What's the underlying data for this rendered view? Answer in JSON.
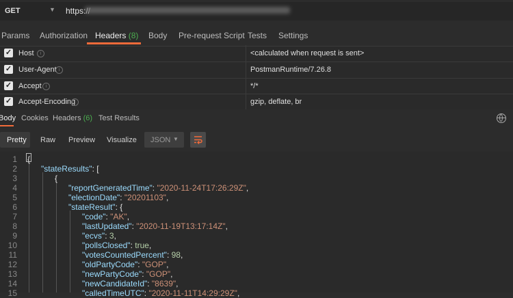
{
  "request": {
    "method": "GET",
    "url_prefix": "https://"
  },
  "request_tabs": {
    "params": "Params",
    "authorization": "Authorization",
    "headers": "Headers",
    "headers_count": "(8)",
    "body": "Body",
    "prerequest": "Pre-request Script",
    "tests": "Tests",
    "settings": "Settings"
  },
  "headers": [
    {
      "key": "Host",
      "value": "<calculated when request is sent>"
    },
    {
      "key": "User-Agent",
      "value": "PostmanRuntime/7.26.8"
    },
    {
      "key": "Accept",
      "value": "*/*"
    },
    {
      "key": "Accept-Encoding",
      "value": "gzip, deflate, br"
    }
  ],
  "response_tabs": {
    "body": "Body",
    "cookies": "Cookies",
    "headers": "Headers",
    "headers_count": "(6)",
    "tests": "Test Results"
  },
  "view_modes": {
    "pretty": "Pretty",
    "raw": "Raw",
    "preview": "Preview",
    "visualize": "Visualize",
    "format": "JSON"
  },
  "code": {
    "line_numbers": [
      "1",
      "2",
      "3",
      "4",
      "5",
      "6",
      "7",
      "8",
      "9",
      "10",
      "11",
      "12",
      "13",
      "14",
      "15"
    ],
    "l1": "{",
    "l2k": "\"stateResults\"",
    "l2r": ": [",
    "l3": "{",
    "l4k": "\"reportGeneratedTime\"",
    "l4v": "\"2020-11-24T17:26:29Z\"",
    "l5k": "\"electionDate\"",
    "l5v": "\"20201103\"",
    "l6k": "\"stateResult\"",
    "l6r": ": {",
    "l7k": "\"code\"",
    "l7v": "\"AK\"",
    "l8k": "\"lastUpdated\"",
    "l8v": "\"2020-11-19T13:17:14Z\"",
    "l9k": "\"ecvs\"",
    "l9v": "3",
    "l10k": "\"pollsClosed\"",
    "l10v": "true",
    "l11k": "\"votesCountedPercent\"",
    "l11v": "98",
    "l12k": "\"oldPartyCode\"",
    "l12v": "\"GOP\"",
    "l13k": "\"newPartyCode\"",
    "l13v": "\"GOP\"",
    "l14k": "\"newCandidateId\"",
    "l14v": "\"8639\"",
    "l15k": "\"calledTimeUTC\"",
    "l15v": "\"2020-11-11T14:29:29Z\""
  },
  "colors": {
    "accent": "#f26b3a",
    "count_green": "#4caf50"
  }
}
